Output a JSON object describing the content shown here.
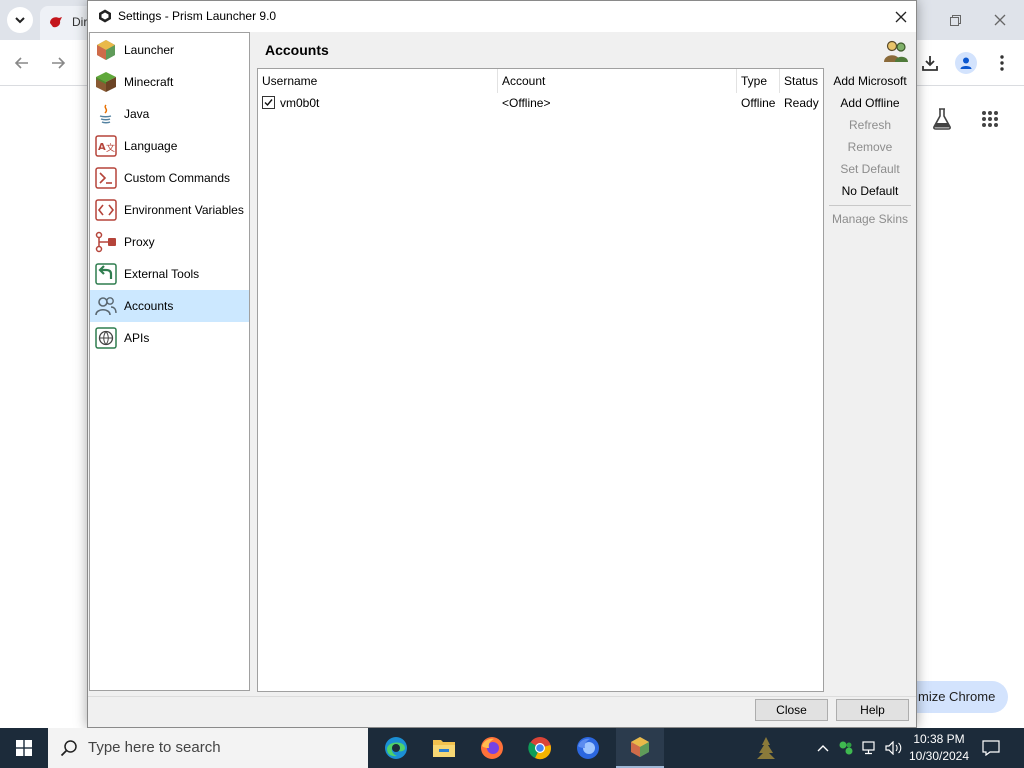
{
  "chrome": {
    "tab_title": "Dir",
    "customize_label": "mize Chrome"
  },
  "dialog": {
    "title": "Settings - Prism Launcher 9.0",
    "close_glyph": "✕",
    "page_title": "Accounts"
  },
  "sidebar": {
    "items": [
      {
        "label": "Launcher",
        "icon": "launcher-icon"
      },
      {
        "label": "Minecraft",
        "icon": "minecraft-grass-block-icon"
      },
      {
        "label": "Java",
        "icon": "java-icon"
      },
      {
        "label": "Language",
        "icon": "language-icon"
      },
      {
        "label": "Custom Commands",
        "icon": "terminal-icon"
      },
      {
        "label": "Environment Variables",
        "icon": "code-brackets-icon"
      },
      {
        "label": "Proxy",
        "icon": "proxy-icon"
      },
      {
        "label": "External Tools",
        "icon": "external-tools-icon"
      },
      {
        "label": "Accounts",
        "icon": "accounts-icon"
      },
      {
        "label": "APIs",
        "icon": "api-globe-icon"
      }
    ],
    "selected": "Accounts"
  },
  "table": {
    "columns": [
      "Username",
      "Account",
      "Type",
      "Status"
    ],
    "rows": [
      {
        "checked": true,
        "username": "vm0b0t",
        "account": "<Offline>",
        "type": "Offline",
        "status": "Ready"
      }
    ]
  },
  "actions": [
    {
      "label": "Add Microsoft",
      "enabled": true
    },
    {
      "label": "Add Offline",
      "enabled": true
    },
    {
      "label": "Refresh",
      "enabled": false
    },
    {
      "label": "Remove",
      "enabled": false
    },
    {
      "label": "Set Default",
      "enabled": false
    },
    {
      "label": "No Default",
      "enabled": true
    },
    {
      "label": "Manage Skins",
      "enabled": false
    }
  ],
  "buttons": {
    "close": "Close",
    "help": "Help"
  },
  "taskbar": {
    "search_placeholder": "Type here to search",
    "apps": [
      "edge-icon",
      "file-explorer-icon",
      "firefox-icon",
      "chrome-icon",
      "firefox-dev-icon",
      "prism-launcher-icon"
    ],
    "time": "10:38 PM",
    "date": "10/30/2024"
  },
  "colors": {
    "selection": "#cce8ff",
    "taskbar": "#1c2b3a",
    "disabled_text": "#8d8d8d"
  }
}
